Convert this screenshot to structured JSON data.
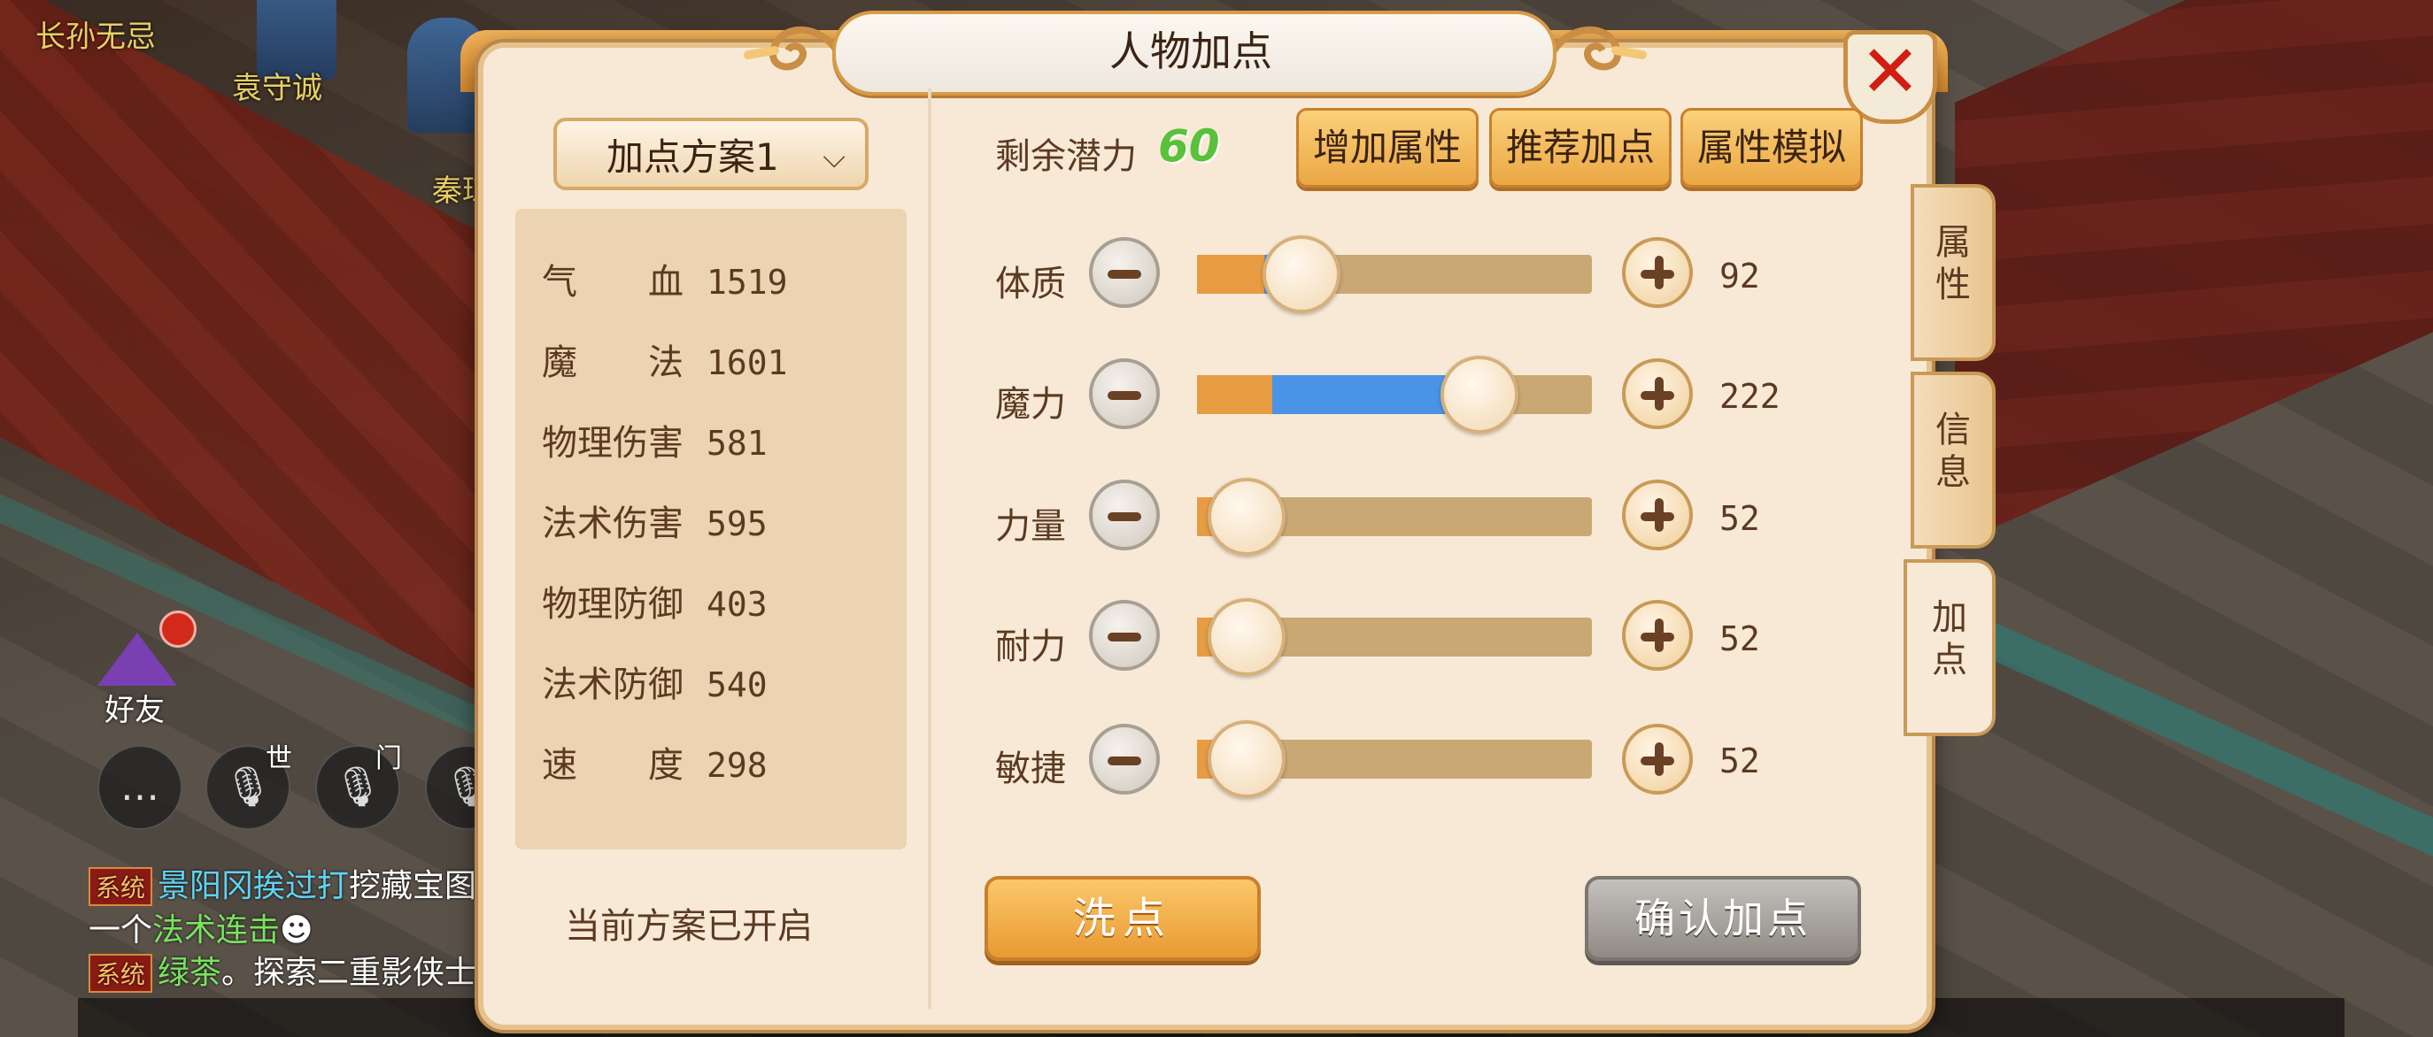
{
  "background": {
    "player_names": [
      "长孙无忌",
      "袁守诚",
      "秦琼"
    ],
    "friend_label": "好友",
    "voice_tags": [
      "世",
      "门"
    ],
    "chat": [
      {
        "tag": "系统",
        "name": "景阳冈挨过打",
        "text": "挖藏宝图"
      },
      {
        "prefix": "一个",
        "highlight": "法术连击",
        "emoji": "☻"
      },
      {
        "tag": "系统",
        "name": "绿茶",
        "text": "。探索二重影侠士"
      }
    ]
  },
  "panel": {
    "title": "人物加点",
    "close_icon": "close-icon",
    "plan_select": {
      "value": "加点方案1",
      "icon": "chevron-down-icon"
    },
    "stats": [
      {
        "label": "气　　血",
        "value": "1519"
      },
      {
        "label": "魔　　法",
        "value": "1601"
      },
      {
        "label": "物理伤害",
        "value": "581"
      },
      {
        "label": "法术伤害",
        "value": "595"
      },
      {
        "label": "物理防御",
        "value": "403"
      },
      {
        "label": "法术防御",
        "value": "540"
      },
      {
        "label": "速　　度",
        "value": "298"
      }
    ],
    "status": "当前方案已开启",
    "remaining_label": "剩余潜力",
    "remaining_value": "60",
    "buttons": {
      "add_attr": "增加属性",
      "recommend": "推荐加点",
      "simulate": "属性模拟",
      "wash": "洗点",
      "confirm": "确认加点"
    },
    "attributes": [
      {
        "label": "体质",
        "value": "92",
        "base_fraction": 0.17,
        "added_fraction": 0.05,
        "knob_fraction": 0.22
      },
      {
        "label": "魔力",
        "value": "222",
        "base_fraction": 0.19,
        "added_fraction": 0.48,
        "knob_fraction": 0.67
      },
      {
        "label": "力量",
        "value": "52",
        "base_fraction": 0.08,
        "added_fraction": 0.0,
        "knob_fraction": 0.08
      },
      {
        "label": "耐力",
        "value": "52",
        "base_fraction": 0.08,
        "added_fraction": 0.0,
        "knob_fraction": 0.08
      },
      {
        "label": "敏捷",
        "value": "52",
        "base_fraction": 0.08,
        "added_fraction": 0.0,
        "knob_fraction": 0.08
      }
    ],
    "side_tabs": [
      {
        "label": "属性",
        "active": false
      },
      {
        "label": "信息",
        "active": false
      },
      {
        "label": "加点",
        "active": true
      }
    ],
    "colors": {
      "base_fill": "#e79c43",
      "added_fill": "#4a93e6",
      "remaining": "#57c23a"
    }
  }
}
